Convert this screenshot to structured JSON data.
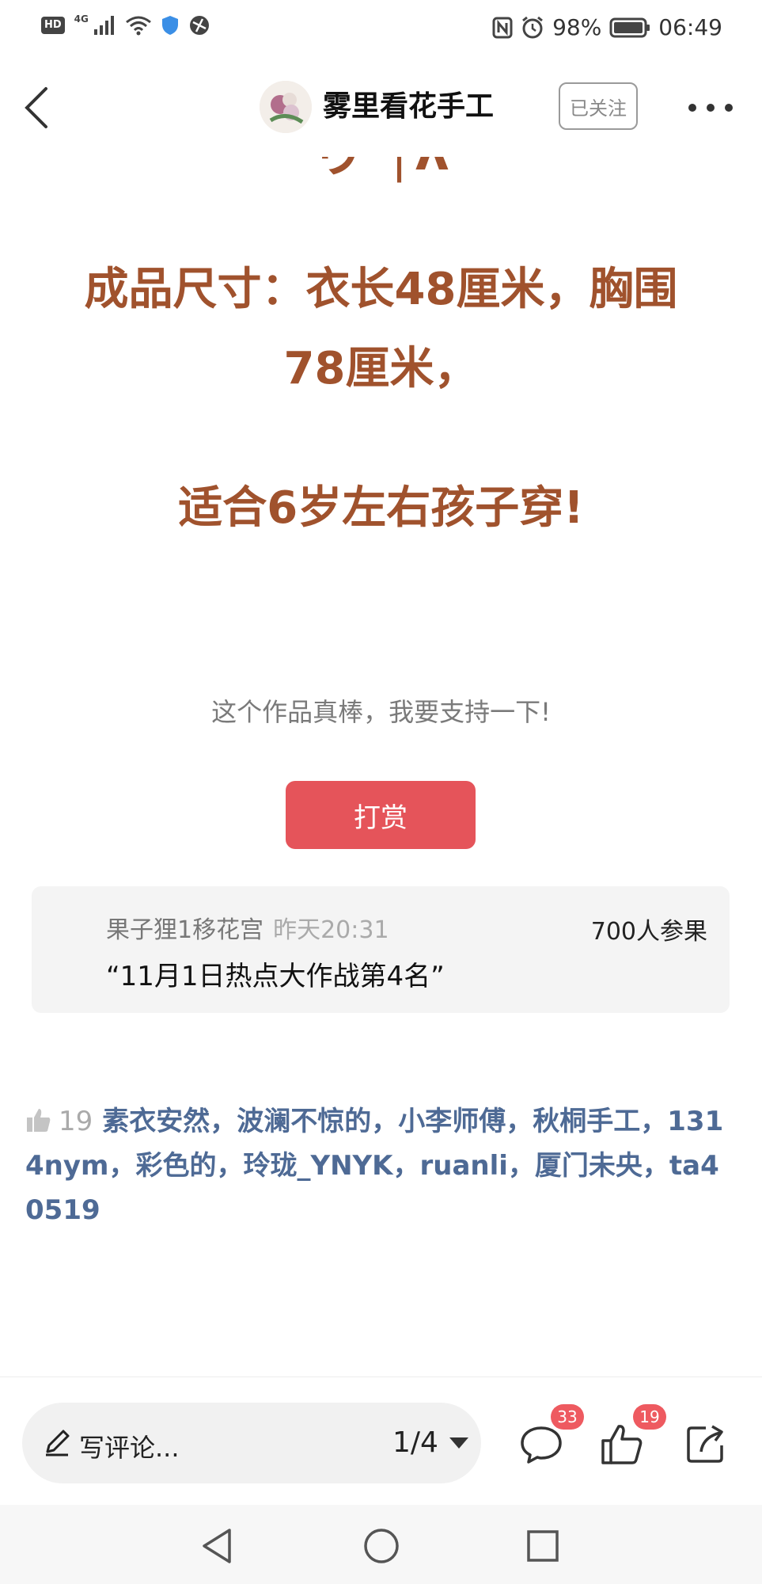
{
  "status_bar": {
    "hd": "HD",
    "network": "4G",
    "battery_pct": "98%",
    "time": "06:49"
  },
  "header": {
    "author_name": "雾里看花手工",
    "follow_label": "已关注"
  },
  "article": {
    "size_line1": "成品尺寸：衣长48厘米，胸围",
    "size_line2": "78厘米，",
    "fit_line": "适合6岁左右孩子穿!"
  },
  "support_text": "这个作品真棒，我要支持一下!",
  "reward_label": "打赏",
  "participation": {
    "name": "果子狸1移花宫",
    "time": "昨天20:31",
    "count": "700人参果",
    "quote": "“11月1日热点大作战第4名”"
  },
  "likes": {
    "count": "19",
    "names": "素衣安然，波澜不惊的，小李师傅，秋桐手工，1314nym，彩色的，玲珑_YNYK，ruanli，厦门未央，ta40519"
  },
  "bottom_bar": {
    "comment_placeholder": "写评论...",
    "page_indicator": "1/4",
    "comment_count": "33",
    "like_count": "19"
  },
  "colors": {
    "article_text": "#a0522d",
    "reward_button": "#e5545a",
    "liker_names": "#4e6a95",
    "badge": "#ee5a60"
  },
  "icons": [
    "back-icon",
    "more-icon",
    "thumb-icon",
    "pen-icon",
    "comment-icon",
    "like-icon",
    "share-icon",
    "nav-back-icon",
    "nav-home-icon",
    "nav-recent-icon"
  ]
}
